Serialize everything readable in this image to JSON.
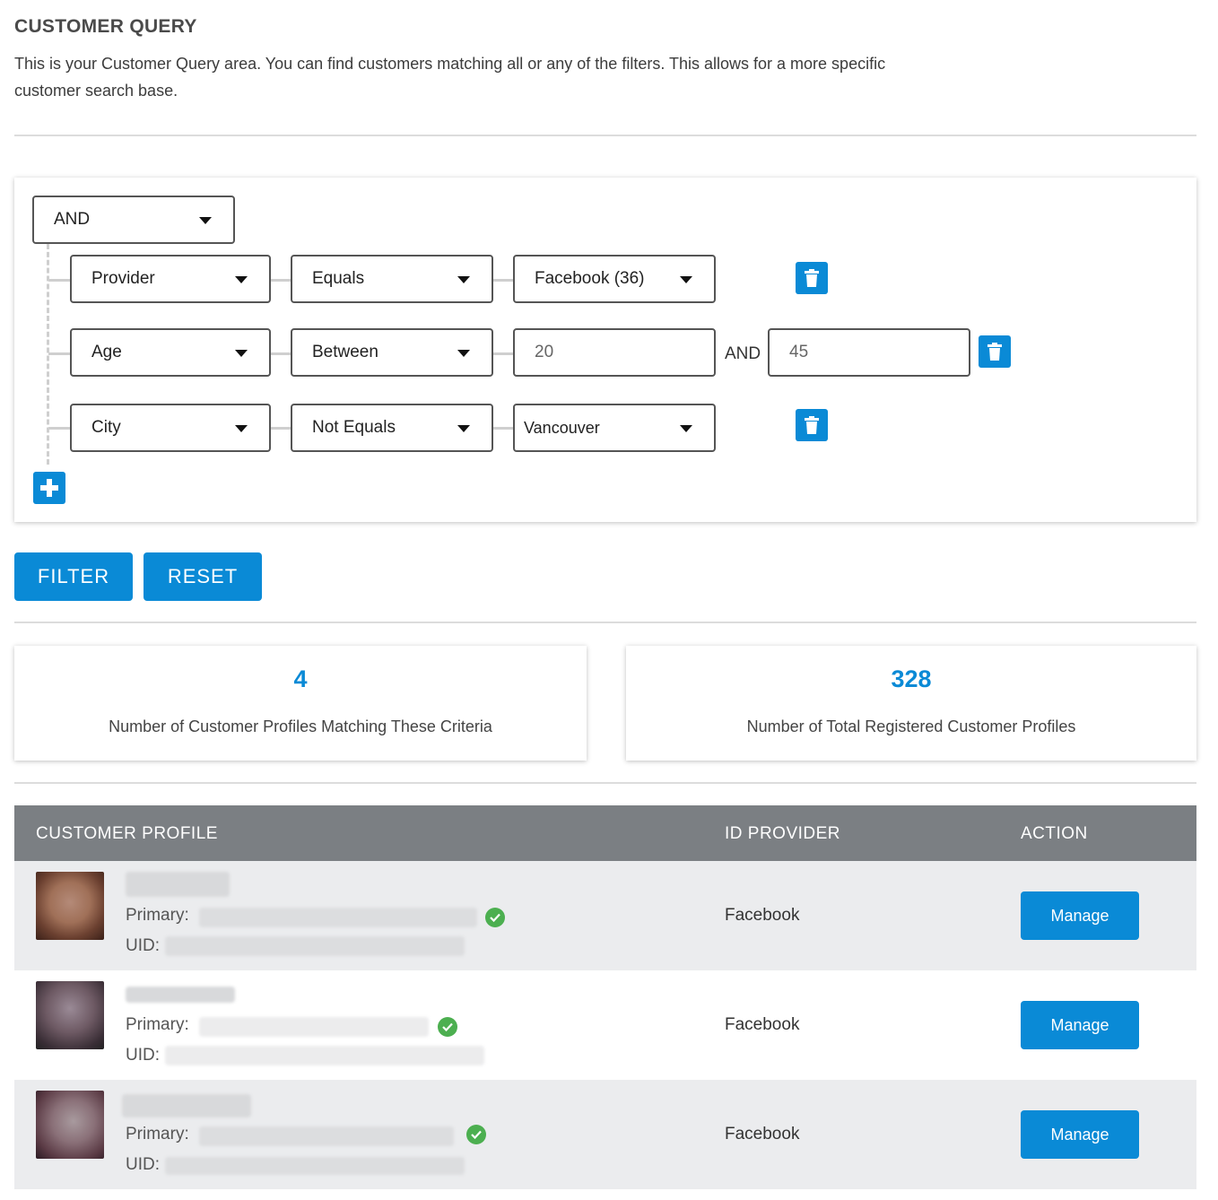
{
  "header": {
    "title": "CUSTOMER QUERY",
    "description": "This is your Customer Query area. You can find customers matching all or any of the filters. This allows for a more specific customer search base."
  },
  "query": {
    "logic_operator": "AND",
    "rules": [
      {
        "field": "Provider",
        "operator": "Equals",
        "value": "Facebook (36)",
        "value_type": "select"
      },
      {
        "field": "Age",
        "operator": "Between",
        "value_from": "20",
        "joiner": "AND",
        "value_to": "45",
        "value_type": "range"
      },
      {
        "field": "City",
        "operator": "Not Equals",
        "value": "Vancouver",
        "value_type": "select"
      }
    ]
  },
  "actions": {
    "filter_label": "FILTER",
    "reset_label": "RESET"
  },
  "stats": {
    "matching_count": "4",
    "matching_label": "Number of Customer Profiles Matching These Criteria",
    "total_count": "328",
    "total_label": "Number of Total Registered Customer Profiles"
  },
  "table": {
    "columns": [
      "CUSTOMER PROFILE",
      "ID PROVIDER",
      "ACTION"
    ],
    "primary_label": "Primary:",
    "uid_label": "UID:",
    "rows": [
      {
        "provider": "Facebook",
        "action": "Manage",
        "verified": true
      },
      {
        "provider": "Facebook",
        "action": "Manage",
        "verified": true
      },
      {
        "provider": "Facebook",
        "action": "Manage",
        "verified": true
      }
    ]
  },
  "colors": {
    "accent": "#0a8ad6",
    "table_header": "#7b7f83",
    "row_shade": "#ebecee",
    "verified": "#4caf50"
  }
}
